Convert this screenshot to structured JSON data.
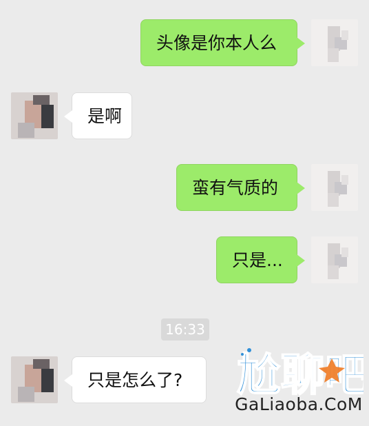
{
  "conversation": {
    "messages": [
      {
        "sender": "self",
        "text": "头像是你本人么"
      },
      {
        "sender": "peer",
        "text": "是啊"
      },
      {
        "sender": "self",
        "text": "蛮有气质的"
      },
      {
        "sender": "self",
        "text": "只是..."
      },
      {
        "sender": "peer",
        "text": "只是怎么了?"
      }
    ],
    "timestamp": "16:33"
  },
  "watermark": {
    "logo_text": "尬聊吧",
    "site": "GaLiaoba.CoM"
  },
  "colors": {
    "background": "#ebebeb",
    "self_bubble": "#9ceb6a",
    "peer_bubble": "#ffffff",
    "timestamp_bg": "#d9d9d9",
    "logo_blue": "#2f8fd8",
    "logo_orange": "#f07a22"
  },
  "icons": {
    "self_avatar": "pixelated-avatar-icon",
    "peer_avatar": "pixelated-avatar-icon"
  }
}
